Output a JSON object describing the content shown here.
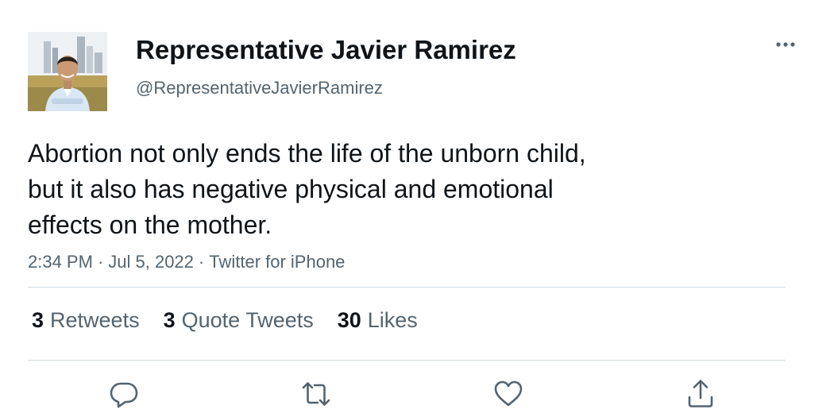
{
  "author": {
    "display_name": "Representative Javier Ramirez",
    "handle": "@RepresentativeJavierRamirez"
  },
  "tweet": {
    "text_lines": [
      "Abortion not only ends the life of the unborn child,",
      "but it also has negative physical and emotional",
      "effects on the mother."
    ],
    "time": "2:34 PM",
    "date": "Jul 5, 2022",
    "source": "Twitter for iPhone",
    "separator": "·"
  },
  "stats": {
    "retweets": {
      "count": "3",
      "label": "Retweets"
    },
    "quote_tweets": {
      "count": "3",
      "label": "Quote Tweets"
    },
    "likes": {
      "count": "30",
      "label": "Likes"
    }
  },
  "icons": {
    "more": "more-icon",
    "reply": "reply-icon",
    "retweet": "retweet-icon",
    "like": "heart-icon",
    "share": "share-icon"
  },
  "colors": {
    "text_primary": "#0f1419",
    "text_secondary": "#536471",
    "divider": "#cfd9de",
    "icon": "#536471"
  }
}
